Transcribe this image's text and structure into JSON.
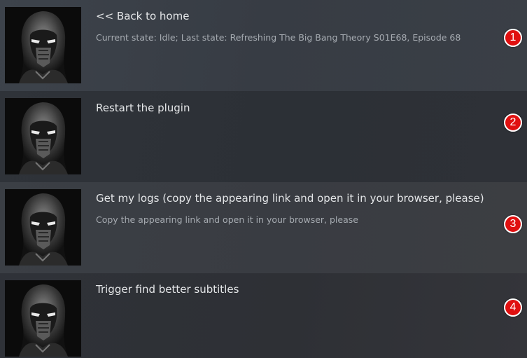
{
  "items": [
    {
      "title": "<< Back to home",
      "subtitle": "Current state: Idle; Last state: Refreshing The Big Bang Theory S01E68, Episode 68",
      "badge": "1"
    },
    {
      "title": "Restart the plugin",
      "subtitle": "",
      "badge": "2"
    },
    {
      "title": "Get my logs (copy the appearing link and open it in your browser, please)",
      "subtitle": "Copy the appearing link and open it in your browser, please",
      "badge": "3"
    },
    {
      "title": "Trigger find better subtitles",
      "subtitle": "",
      "badge": "4"
    }
  ],
  "colors": {
    "badge": "#e01010",
    "title_text": "#e4e6e8",
    "subtitle_text": "#a6abb1"
  }
}
